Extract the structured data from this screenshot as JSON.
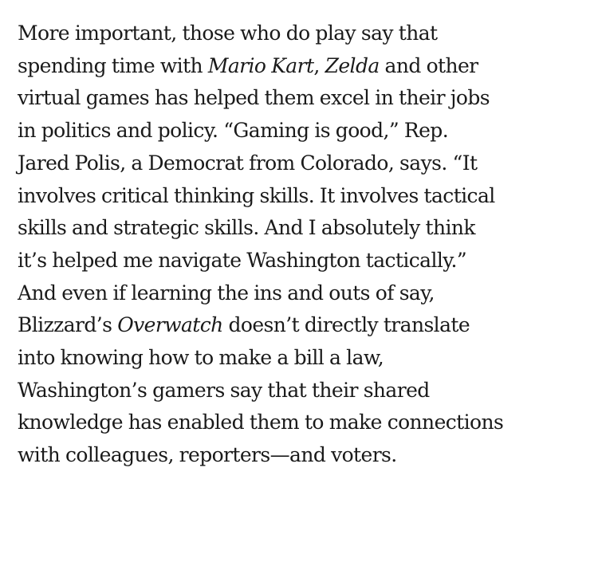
{
  "article": {
    "paragraph": {
      "l1": "More important, those who do play say that",
      "l2_a": "spending time with ",
      "l2_title1": "Mario Kart",
      "l2_b": ", ",
      "l2_title2": "Zelda",
      "l2_c": " and other",
      "l3": "virtual games has helped them excel in their jobs",
      "l4": "in politics and policy. “Gaming is good,” Rep.",
      "l5": "Jared Polis, a Democrat from Colorado, says. “It",
      "l6": "involves critical thinking skills. It involves tactical",
      "l7": "skills and strategic skills. And I absolutely think",
      "l8": "it’s helped me navigate Washington tactically.”",
      "l9": "And even if learning the ins and outs of say,",
      "l10_a": "Blizzard’s ",
      "l10_title": "Overwatch",
      "l10_b": " doesn’t directly translate",
      "l11": "into knowing how to make a bill a law,",
      "l12": "Washington’s gamers say that their shared",
      "l13": "knowledge has enabled them to make connections",
      "l14": "with colleagues, reporters—and voters."
    }
  }
}
